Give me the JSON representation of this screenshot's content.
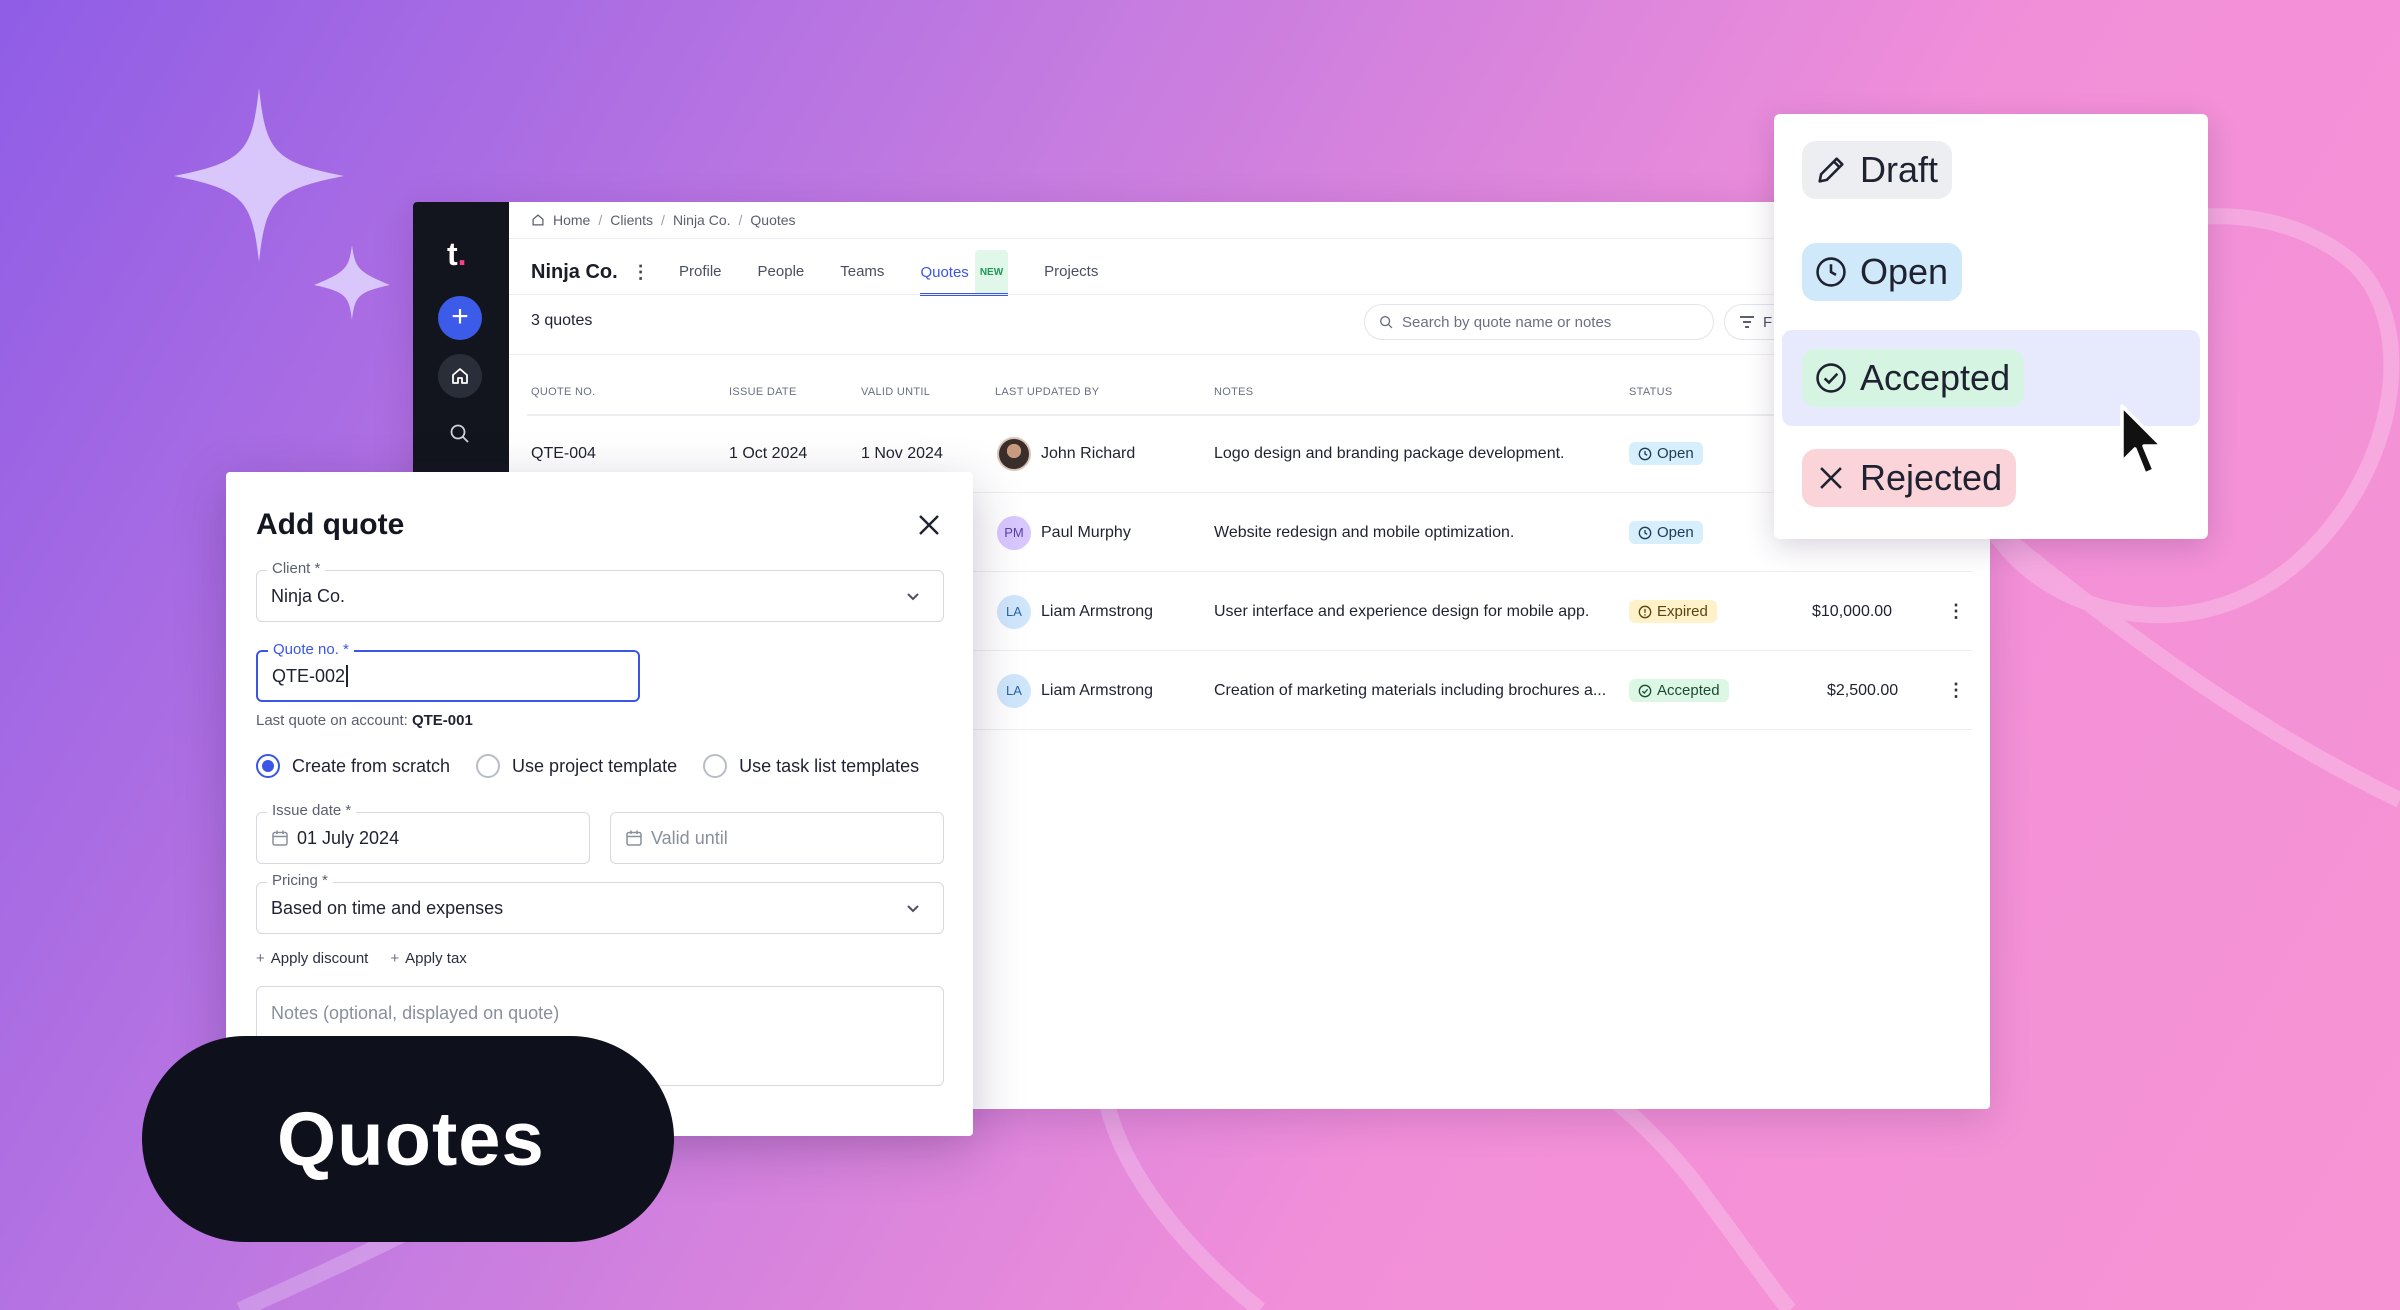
{
  "brand": {
    "logo_letter": "t",
    "logo_dot": "."
  },
  "breadcrumb": [
    "Home",
    "Clients",
    "Ninja Co.",
    "Quotes"
  ],
  "page": {
    "company": "Ninja Co."
  },
  "tabs": [
    {
      "label": "Profile"
    },
    {
      "label": "People"
    },
    {
      "label": "Teams"
    },
    {
      "label": "Quotes",
      "badge": "NEW",
      "active": true
    },
    {
      "label": "Projects"
    }
  ],
  "toolbar": {
    "count": "3 quotes",
    "search_placeholder": "Search by quote name or notes",
    "filter_label": "F"
  },
  "table": {
    "headers": [
      "QUOTE NO.",
      "ISSUE DATE",
      "VALID UNTIL",
      "LAST UPDATED BY",
      "NOTES",
      "STATUS"
    ],
    "rows": [
      {
        "quote_no": "QTE-004",
        "issue_date": "1 Oct 2024",
        "valid_until": "1 Nov 2024",
        "avatar": "",
        "updated_by": "John Richard",
        "notes": "Logo design and branding package development.",
        "status": "Open",
        "amount": ""
      },
      {
        "quote_no": "",
        "issue_date": "",
        "valid_until": "",
        "avatar": "PM",
        "updated_by": "Paul Murphy",
        "notes": "Website redesign and mobile optimization.",
        "status": "Open",
        "amount": ""
      },
      {
        "quote_no": "",
        "issue_date": "",
        "valid_until": "",
        "avatar": "LA",
        "updated_by": "Liam Armstrong",
        "notes": "User interface and experience design for mobile app.",
        "status": "Expired",
        "amount": "$10,000.00"
      },
      {
        "quote_no": "",
        "issue_date": "",
        "valid_until": "",
        "avatar": "LA",
        "updated_by": "Liam Armstrong",
        "notes": "Creation of marketing materials including brochures a...",
        "status": "Accepted",
        "amount": "$2,500.00"
      }
    ]
  },
  "status_menu": {
    "items": [
      {
        "label": "Draft",
        "icon": "pencil-icon"
      },
      {
        "label": "Open",
        "icon": "clock-icon"
      },
      {
        "label": "Accepted",
        "icon": "check-circle-icon",
        "hovered": true
      },
      {
        "label": "Rejected",
        "icon": "x-icon"
      }
    ]
  },
  "modal": {
    "title": "Add quote",
    "client_label": "Client *",
    "client_value": "Ninja Co.",
    "quote_no_label": "Quote no. *",
    "quote_no_value": "QTE-002",
    "hint_prefix": "Last quote on account:",
    "hint_value": "QTE-001",
    "radios": [
      {
        "label": "Create from scratch",
        "checked": true
      },
      {
        "label": "Use project template",
        "checked": false
      },
      {
        "label": "Use task list templates",
        "checked": false
      }
    ],
    "issue_date_label": "Issue date *",
    "issue_date_value": "01 July 2024",
    "valid_until_placeholder": "Valid until",
    "pricing_label": "Pricing *",
    "pricing_value": "Based on time and expenses",
    "apply_discount": "Apply discount",
    "apply_tax": "Apply tax",
    "notes_placeholder": "Notes (optional, displayed on quote)"
  },
  "feature_label": "Quotes",
  "colors": {
    "accent": "#3b55e6",
    "rail": "#12151d",
    "label_bg": "#0e111c"
  }
}
